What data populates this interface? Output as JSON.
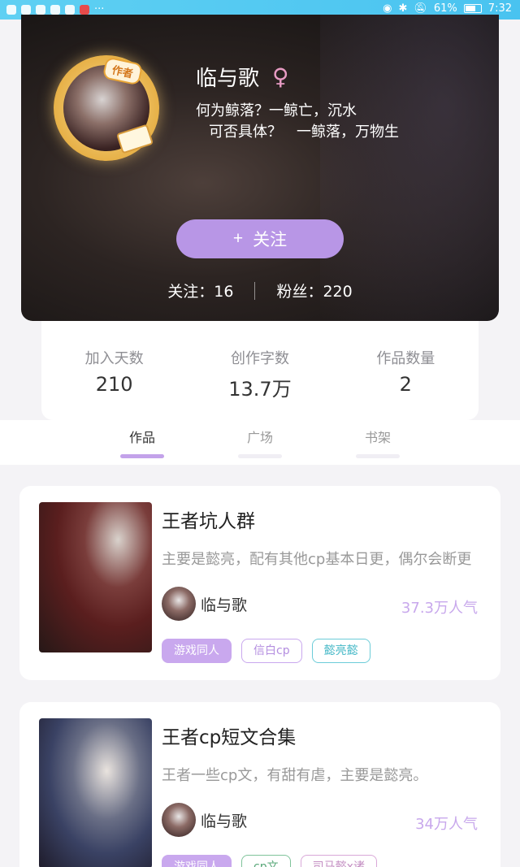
{
  "status_bar": {
    "battery": "61%",
    "time": "7:32"
  },
  "profile": {
    "username": "临与歌",
    "badge": "作者",
    "signature_line1": "何为鲸落？一鲸亡，沉水",
    "signature_line2": "可否具体？　一鲸落，万物生",
    "follow_button": "关注",
    "following": "关注：16",
    "fans": "粉丝：220"
  },
  "stats": [
    {
      "label": "加入天数",
      "value": "210"
    },
    {
      "label": "创作字数",
      "value": "13.7万"
    },
    {
      "label": "作品数量",
      "value": "2"
    }
  ],
  "tabs": [
    "作品",
    "广场",
    "书架"
  ],
  "works": [
    {
      "title": "王者坑人群",
      "desc": "主要是懿亮，配有其他cp基本日更，偶尔会断更",
      "author": "临与歌",
      "popularity": "37.3万人气",
      "tags": [
        "游戏同人",
        "信白cp",
        "懿亮懿"
      ]
    },
    {
      "title": "王者cp短文合集",
      "desc": "王者一些cp文，有甜有虐，主要是懿亮。",
      "author": "临与歌",
      "popularity": "34万人气",
      "tags": [
        "游戏同人",
        "cp文",
        "司马懿x诸"
      ]
    }
  ]
}
